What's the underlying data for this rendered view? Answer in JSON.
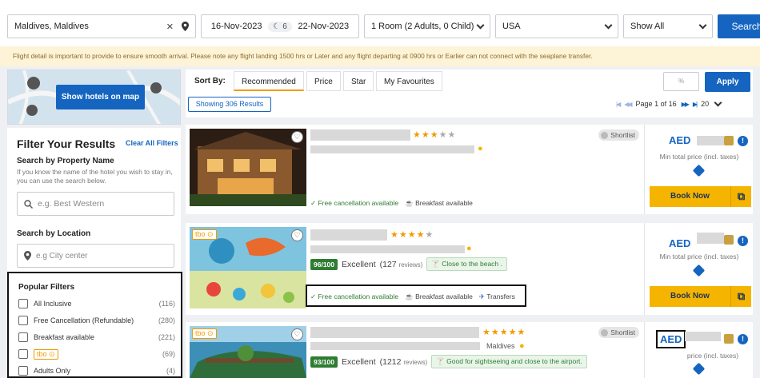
{
  "search": {
    "destination": "Maldives, Maldives",
    "check_in": "16-Nov-2023",
    "nights": "6",
    "check_out": "22-Nov-2023",
    "rooms": "1 Room (2 Adults, 0 Child)",
    "nationality": "USA",
    "show_filter": "Show All",
    "search_label": "Search"
  },
  "notice": "Flight detail is important to provide to ensure smooth arrival. Please note any flight landing 1500 hrs or Later and any flight departing at 0900 hrs or Earlier can not connect with the seaplane transfer.",
  "map": {
    "button_label": "Show hotels on map"
  },
  "filters": {
    "heading": "Filter Your Results",
    "clear_all": "Clear All Filters",
    "property_title": "Search by Property Name",
    "property_help": "If you know the name of the hotel you wish to stay in, you can use the search below.",
    "property_placeholder": "e.g. Best Western",
    "location_title": "Search by Location",
    "location_placeholder": "e.g City center",
    "popular_title": "Popular Filters",
    "popular": [
      {
        "label": "All Inclusive",
        "count": "(116)"
      },
      {
        "label": "Free Cancellation (Refundable)",
        "count": "(280)"
      },
      {
        "label": "Breakfast available",
        "count": "(221)"
      },
      {
        "label": "tbo",
        "count": "(69)"
      },
      {
        "label": "Adults Only",
        "count": "(4)"
      }
    ]
  },
  "sort": {
    "label": "Sort By:",
    "tabs": [
      "Recommended",
      "Price",
      "Star",
      "My Favourites"
    ],
    "input_placeholder": "%",
    "apply_label": "Apply",
    "results_label": "Showing 306 Results",
    "page_text": "Page 1 of 16",
    "per_page": "20"
  },
  "cards": [
    {
      "stars": 3,
      "shortlist": "Shortlist",
      "amenities": [
        "Free cancellation available",
        "Breakfast available"
      ],
      "currency": "AED",
      "min_price_label": "Min total price (incl. taxes)",
      "book_label": "Book Now"
    },
    {
      "tbo": "tbo",
      "stars": 4,
      "shortlist": "Shortlist",
      "score": "96/100",
      "rating_word": "Excellent",
      "reviews": "(127",
      "reviews_word": "reviews)",
      "note": "Close to the beach .",
      "amenities": [
        "Free cancellation available",
        "Breakfast available",
        "Transfers"
      ],
      "currency": "AED",
      "min_price_label": "Min total price (incl. taxes)",
      "book_label": "Book Now"
    },
    {
      "tbo": "tbo",
      "stars": 5,
      "shortlist": "Shortlist",
      "location": "Maldives",
      "score": "93/100",
      "rating_word": "Excellent",
      "reviews": "(1212",
      "reviews_word": "reviews)",
      "note": "Good for sightseeing and close to the airport.",
      "currency": "AED",
      "min_price_label": "price (incl. taxes)"
    }
  ],
  "colors": {
    "primary": "#1565c0",
    "accent": "#f29a00",
    "book": "#f5b400",
    "green": "#2e7d32"
  }
}
